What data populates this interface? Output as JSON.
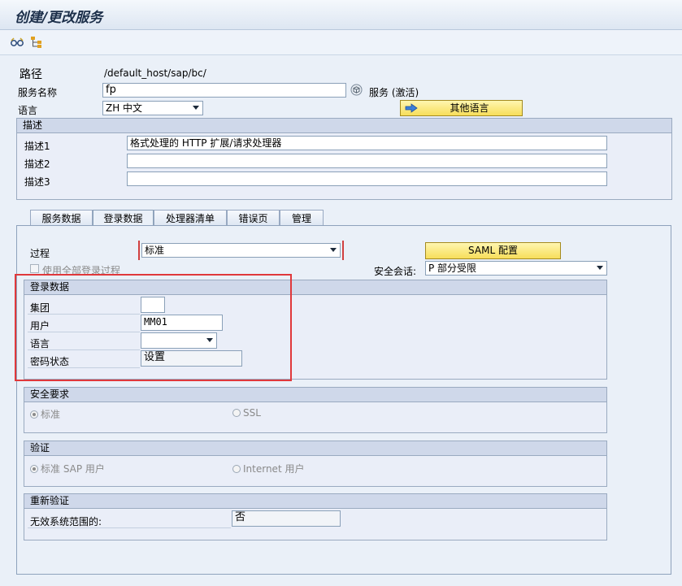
{
  "window": {
    "title": "创建/更改服务"
  },
  "toolbar": {
    "icons": [
      "glasses-icon",
      "hierarchy-icon"
    ]
  },
  "header": {
    "path_label": "路径",
    "path_value": "/default_host/sap/bc/",
    "service_name_label": "服务名称",
    "service_name_value": "fp",
    "service_status": "服务 (激活)",
    "language_label": "语言",
    "language_value": "ZH 中文",
    "other_lang_button": "其他语言"
  },
  "description": {
    "title": "描述",
    "rows": [
      {
        "label": "描述1",
        "value": "格式处理的 HTTP 扩展/请求处理器"
      },
      {
        "label": "描述2",
        "value": ""
      },
      {
        "label": "描述3",
        "value": ""
      }
    ]
  },
  "tabs": [
    "服务数据",
    "登录数据",
    "处理器清单",
    "错误页",
    "管理"
  ],
  "active_tab": "登录数据",
  "logon": {
    "procedure_label": "过程",
    "procedure_value": "标准",
    "saml_button": "SAML 配置",
    "use_all_label": "使用全部登录过程",
    "security_session_label": "安全会话:",
    "security_session_value": "P 部分受限",
    "logon_data_group": {
      "title": "登录数据",
      "client_label": "集团",
      "client_value": "",
      "user_label": "用户",
      "user_value": "MM01",
      "language_label": "语言",
      "language_value": "",
      "password_label": "密码状态",
      "password_value": "设置"
    },
    "security_req": {
      "title": "安全要求",
      "opt1": "标准",
      "opt2": "SSL"
    },
    "auth": {
      "title": "验证",
      "opt1": "标准 SAP 用户",
      "opt2": "Internet 用户"
    },
    "reauth": {
      "title": "重新验证",
      "label": "无效系统范围的:",
      "value": "否"
    }
  },
  "colors": {
    "highlight_box": "#e0383b",
    "button_yellow": "#f7de5a",
    "group_header": "#cfd8ea"
  }
}
